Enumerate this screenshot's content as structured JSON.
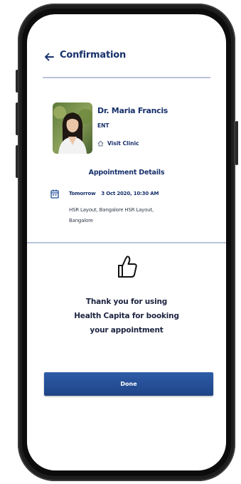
{
  "header": {
    "title": "Confirmation",
    "back_icon": "arrow-left-icon"
  },
  "doctor": {
    "name": "Dr. Maria Francis",
    "specialty": "ENT",
    "visit_clinic_label": "Visit Clinic",
    "visit_clinic_icon": "home-icon"
  },
  "appointment": {
    "section_title": "Appointment Details",
    "icon": "calendar-icon",
    "day": "Tomorrow",
    "date_time": "3 Oct 2020, 10:30 AM",
    "address_line1": "HSR Layout, Bangalore HSR Layout,",
    "address_line2": "Bangalore"
  },
  "confirmation": {
    "icon": "thumbs-up-icon",
    "line1": "Thank you for using",
    "line2": "Health Capita for booking",
    "line3": "your appointment"
  },
  "actions": {
    "done_label": "Done"
  },
  "colors": {
    "primary_text": "#17306b",
    "button": "#2a57a0",
    "divider": "#b9c4da",
    "device": "#1e1e1e"
  }
}
